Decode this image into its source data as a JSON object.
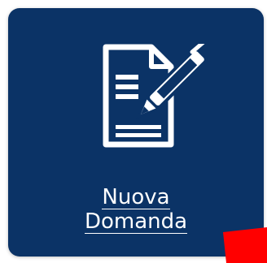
{
  "tile": {
    "label_line1": "Nuova",
    "label_line2": "Domanda",
    "icon": "document-edit-icon",
    "background_color": "#0b3366",
    "text_color": "#ffffff"
  },
  "corner_mark": {
    "color": "#ff0000"
  }
}
